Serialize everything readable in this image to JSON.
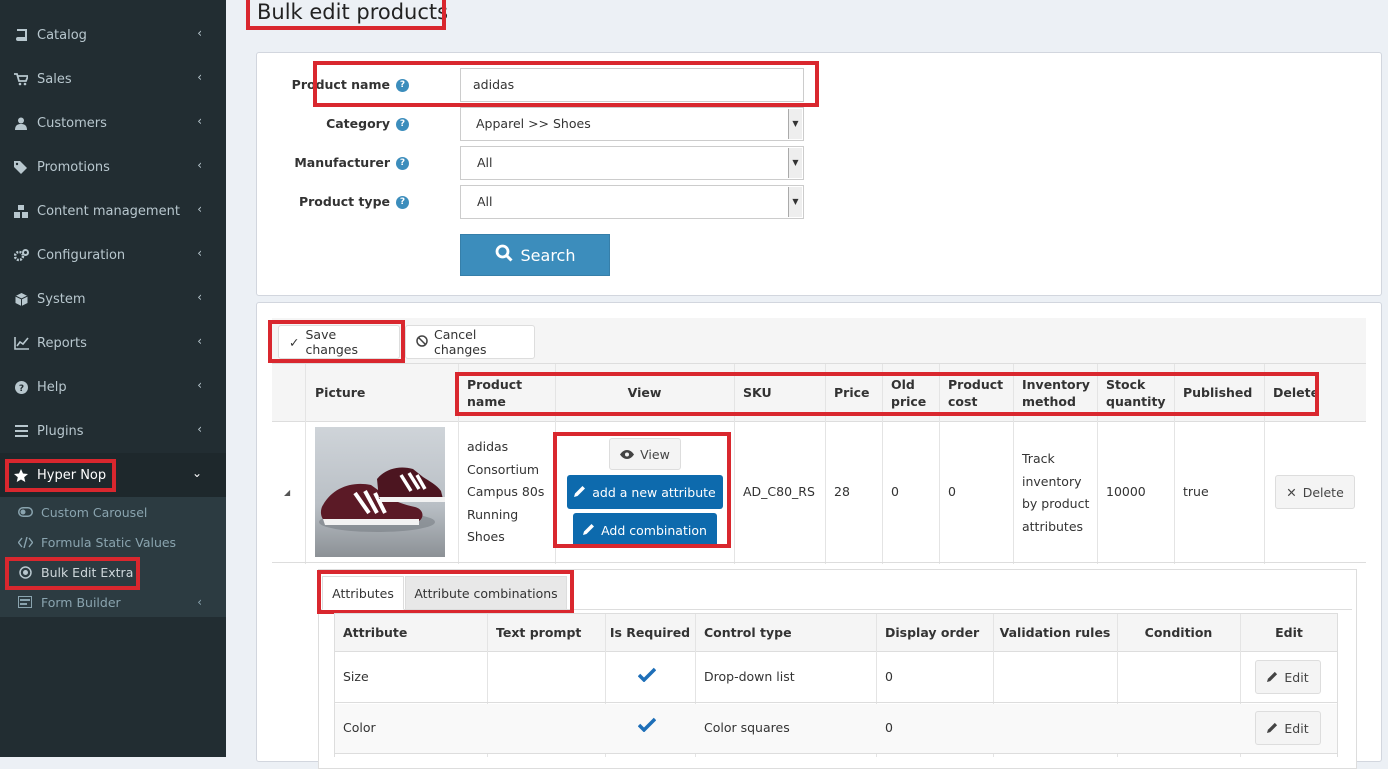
{
  "sidebar": {
    "items": [
      {
        "label": "Catalog",
        "icon": "book-icon"
      },
      {
        "label": "Sales",
        "icon": "cart-icon"
      },
      {
        "label": "Customers",
        "icon": "user-icon"
      },
      {
        "label": "Promotions",
        "icon": "tags-icon"
      },
      {
        "label": "Content management",
        "icon": "cubes-icon"
      },
      {
        "label": "Configuration",
        "icon": "gears-icon"
      },
      {
        "label": "System",
        "icon": "cube-icon"
      },
      {
        "label": "Reports",
        "icon": "line-chart-icon"
      },
      {
        "label": "Help",
        "icon": "question-circle-icon"
      },
      {
        "label": "Plugins",
        "icon": "bars-icon"
      },
      {
        "label": "Hyper Nop",
        "icon": "star-icon"
      }
    ],
    "subitems": [
      {
        "label": "Custom Carousel",
        "icon": "toggle-icon"
      },
      {
        "label": "Formula Static Values",
        "icon": "code-icon"
      },
      {
        "label": "Bulk Edit Extra",
        "icon": "dot-circle-icon"
      },
      {
        "label": "Form Builder",
        "icon": "form-icon"
      }
    ]
  },
  "page": {
    "title": "Bulk edit products"
  },
  "search": {
    "product_name_label": "Product name",
    "product_name_value": "adidas",
    "category_label": "Category",
    "category_value": "Apparel >> Shoes",
    "manufacturer_label": "Manufacturer",
    "manufacturer_value": "All",
    "product_type_label": "Product type",
    "product_type_value": "All",
    "search_button": "Search"
  },
  "toolbar": {
    "save": "Save changes",
    "cancel": "Cancel changes"
  },
  "grid": {
    "headers": {
      "picture": "Picture",
      "product_name": "Product name",
      "view": "View",
      "sku": "SKU",
      "price": "Price",
      "old_price": "Old price",
      "product_cost": "Product cost",
      "inventory_method": "Inventory method",
      "stock_quantity": "Stock quantity",
      "published": "Published",
      "delete": "Delete"
    },
    "row": {
      "name": "adidas Consortium Campus 80s Running Shoes",
      "view_btn": "View",
      "add_attr_btn": "add a new attribute",
      "add_combo_btn": "Add combination",
      "sku": "AD_C80_RS",
      "price": "28",
      "old_price": "0",
      "product_cost": "0",
      "inventory_method": "Track inventory by product attributes",
      "stock_quantity": "10000",
      "published": "true",
      "delete_btn": "Delete"
    }
  },
  "tabs": {
    "attributes": "Attributes",
    "combinations": "Attribute combinations"
  },
  "attributes": {
    "headers": [
      "Attribute",
      "Text prompt",
      "Is Required",
      "Control type",
      "Display order",
      "Validation rules",
      "Condition",
      "Edit"
    ],
    "rows": [
      {
        "attribute": "Size",
        "text_prompt": "",
        "required": true,
        "control_type": "Drop-down list",
        "display_order": "0",
        "edit": "Edit"
      },
      {
        "attribute": "Color",
        "text_prompt": "",
        "required": true,
        "control_type": "Color squares",
        "display_order": "0",
        "edit": "Edit"
      }
    ]
  },
  "colors": {
    "highlight": "#d9272e",
    "primary": "#3c8dbc",
    "sidebar": "#222d32"
  }
}
